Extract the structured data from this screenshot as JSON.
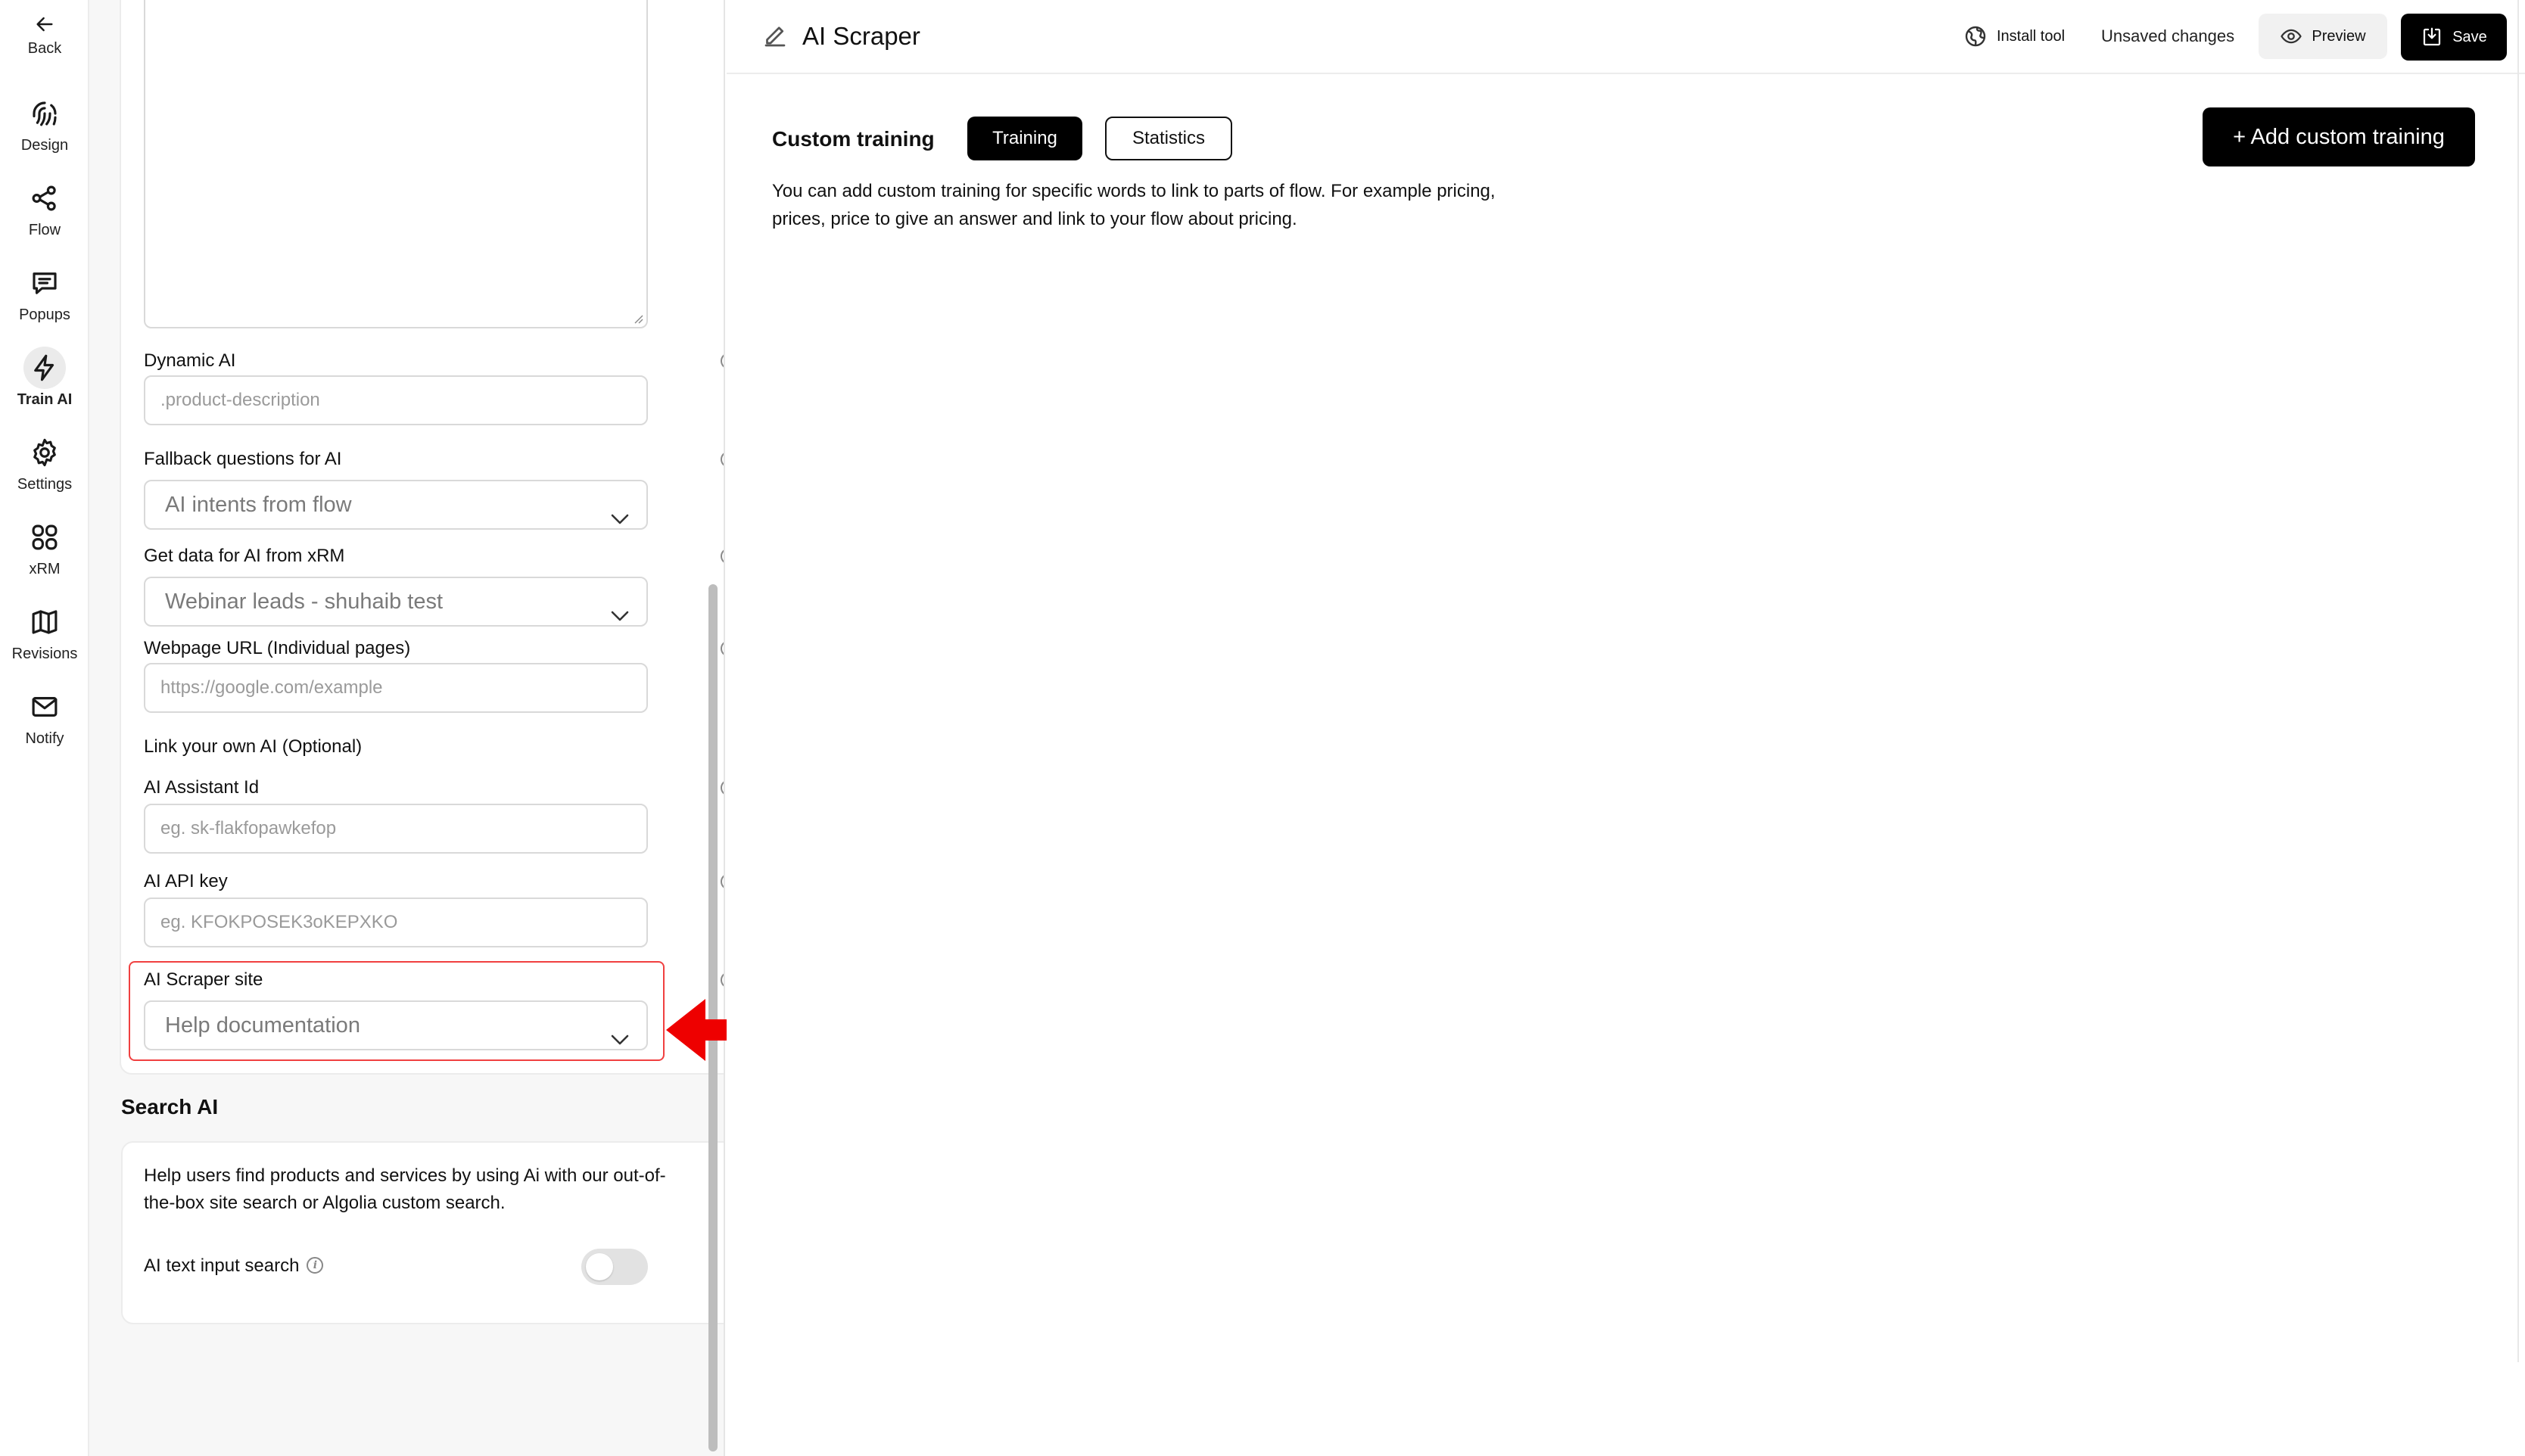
{
  "nav": {
    "back": "Back",
    "items": [
      {
        "label": "Design",
        "icon": "fingerprint-icon"
      },
      {
        "label": "Flow",
        "icon": "flow-icon"
      },
      {
        "label": "Popups",
        "icon": "message-icon"
      },
      {
        "label": "Train AI",
        "icon": "lightning-icon"
      },
      {
        "label": "Settings",
        "icon": "gear-icon"
      },
      {
        "label": "xRM",
        "icon": "grid-icon"
      },
      {
        "label": "Revisions",
        "icon": "map-icon"
      },
      {
        "label": "Notify",
        "icon": "mail-icon"
      }
    ],
    "active_index": 3
  },
  "panel": {
    "dynamic_ai": {
      "label": "Dynamic AI",
      "placeholder": ".product-description"
    },
    "fallback": {
      "label": "Fallback questions for AI",
      "value": "AI intents from flow"
    },
    "xrm": {
      "label": "Get data for AI from xRM",
      "value": "Webinar leads - shuhaib test"
    },
    "webpage": {
      "label": "Webpage URL (Individual pages)",
      "placeholder": "https://google.com/example"
    },
    "link_own_ai": {
      "label": "Link your own AI (Optional)"
    },
    "assistant_id": {
      "label": "AI Assistant Id",
      "placeholder": "eg. sk-flakfopawkefop"
    },
    "api_key": {
      "label": "AI API key",
      "placeholder": "eg. KFOKPOSEK3oKEPXKO"
    },
    "scraper_site": {
      "label": "AI Scraper site",
      "value": "Help documentation"
    },
    "search_ai": {
      "title": "Search AI",
      "description": "Help users find products and services by using Ai with our out-of-the-box site search or Algolia custom search.",
      "toggle_label": "AI text input search",
      "toggle_on": false
    }
  },
  "header": {
    "title": "AI Scraper",
    "install_tool": "Install tool",
    "unsaved": "Unsaved changes",
    "preview": "Preview",
    "save": "Save"
  },
  "main": {
    "section_title": "Custom training",
    "tabs": [
      {
        "label": "Training",
        "active": true
      },
      {
        "label": "Statistics",
        "active": false
      }
    ],
    "description": "You can add custom training for specific words to link to parts of flow. For example pricing, prices, price to give an answer and link to your flow about pricing.",
    "add_button": "+ Add custom training"
  },
  "colors": {
    "accent": "#000000",
    "highlight": "#f04040",
    "arrow": "#ee0000"
  }
}
